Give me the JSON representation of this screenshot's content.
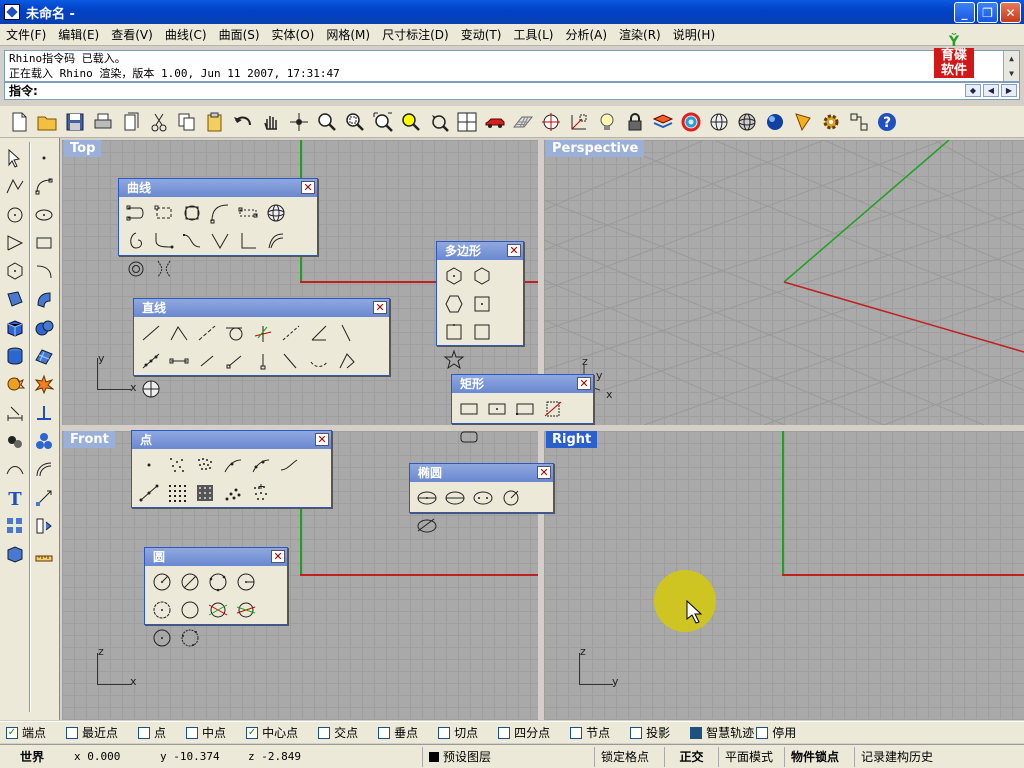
{
  "window": {
    "title": "未命名 -"
  },
  "menu": [
    "文件(F)",
    "编辑(E)",
    "查看(V)",
    "曲线(C)",
    "曲面(S)",
    "实体(O)",
    "网格(M)",
    "尺寸标注(D)",
    "变动(T)",
    "工具(L)",
    "分析(A)",
    "渲染(R)",
    "说明(H)"
  ],
  "history": [
    "Rhino指令码 已载入。",
    "正在载入 Rhino 渲染，版本 1.00, Jun 11 2007, 17:31:47"
  ],
  "command": {
    "prompt": "指令:"
  },
  "logo": {
    "text1": "育碟",
    "text2": "软件"
  },
  "toolbar_icons": [
    "new-icon",
    "open-icon",
    "save-icon",
    "print-icon",
    "import-icon",
    "cut-icon",
    "copy-icon",
    "paste-icon",
    "undo-icon",
    "pan-icon",
    "rotate-view-icon",
    "zoom-dynamic-icon",
    "zoom-window-icon",
    "zoom-extents-icon",
    "zoom-selected-icon",
    "undo-view-icon",
    "four-viewports-icon",
    "car-icon",
    "grid-icon",
    "osnap-icon",
    "cplane-icon",
    "light-icon",
    "lock-icon",
    "layer-icon",
    "color-icon",
    "wireframe-icon",
    "ghosted-icon",
    "render-icon",
    "cone-icon",
    "settings-icon",
    "options-icon",
    "help-icon"
  ],
  "viewports": {
    "top": {
      "label": "Top",
      "ax1": "y",
      "ax2": "x"
    },
    "perspective": {
      "label": "Perspective",
      "ax1": "z",
      "ax2": "y",
      "ax3": "x"
    },
    "front": {
      "label": "Front",
      "ax1": "z",
      "ax2": "x"
    },
    "right": {
      "label": "Right",
      "ax1": "z",
      "ax2": "y"
    }
  },
  "panels": {
    "curve": {
      "title": "曲线"
    },
    "line": {
      "title": "直线"
    },
    "polygon": {
      "title": "多边形"
    },
    "rect": {
      "title": "矩形"
    },
    "point": {
      "title": "点"
    },
    "ellipse": {
      "title": "椭圆"
    },
    "circle": {
      "title": "圆"
    }
  },
  "osnaps": [
    {
      "label": "端点",
      "checked": true
    },
    {
      "label": "最近点",
      "checked": false
    },
    {
      "label": "点",
      "checked": false
    },
    {
      "label": "中点",
      "checked": false
    },
    {
      "label": "中心点",
      "checked": true
    },
    {
      "label": "交点",
      "checked": false
    },
    {
      "label": "垂点",
      "checked": false
    },
    {
      "label": "切点",
      "checked": false
    },
    {
      "label": "四分点",
      "checked": false
    },
    {
      "label": "节点",
      "checked": false
    },
    {
      "label": "投影",
      "checked": false
    },
    {
      "label": "智慧轨迹",
      "checked": true
    },
    {
      "label": "停用",
      "checked": false
    }
  ],
  "status": {
    "world": "世界",
    "x": "x 0.000",
    "y": "y -10.374",
    "z": "z -2.849",
    "layer": "预设图层",
    "snap": "锁定格点",
    "ortho": "正交",
    "planar": "平面模式",
    "osnap": "物件锁点",
    "history": "记录建构历史"
  },
  "colors": {
    "accent": "#2b60cc",
    "xaxis": "#c02020",
    "yaxis": "#20a020",
    "viewport_bg": "#a9a9a9"
  }
}
